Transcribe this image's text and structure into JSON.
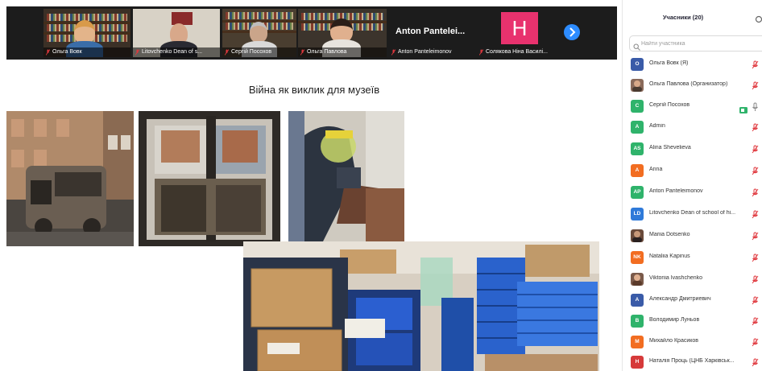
{
  "video_strip": {
    "tiles": [
      {
        "caption": "Ольга Вовк"
      },
      {
        "caption": "Litovchenko Dean of s..."
      },
      {
        "caption": "Сергій Посохов"
      },
      {
        "caption": "Ольга Павлова"
      },
      {
        "name": "Anton Pantelei...",
        "caption": "Anton Panteleimonov"
      },
      {
        "avatar_letter": "Н",
        "caption": "Солякова Ніна Василі..."
      }
    ],
    "next_icon": "chevron-right-icon"
  },
  "slide": {
    "title": "Війна як виклик для музеїв"
  },
  "participants": {
    "title": "Учасники (20)",
    "search_placeholder": "Найти участника",
    "items": [
      {
        "initials": "О",
        "name": "Ольга Вовк (Я)",
        "color": "#3a5ba8",
        "mic": "muted"
      },
      {
        "initials": "",
        "name": "Ольга Павлова (Организатор)",
        "color": "#8a6a5a",
        "mic": "muted",
        "photo": true
      },
      {
        "initials": "С",
        "name": "Сергій Посохов",
        "color": "#2fb36b",
        "mic": "on",
        "video": true
      },
      {
        "initials": "A",
        "name": "Admin",
        "color": "#2fb36b",
        "mic": "muted"
      },
      {
        "initials": "AS",
        "name": "Alina Shevelieva",
        "color": "#2fb36b",
        "mic": "muted"
      },
      {
        "initials": "A",
        "name": "Anna",
        "color": "#f26d21",
        "mic": "muted"
      },
      {
        "initials": "AP",
        "name": "Anton Panteleimonov",
        "color": "#2fb36b",
        "mic": "muted"
      },
      {
        "initials": "LD",
        "name": "Litovchenko Dean of school of hi...",
        "color": "#2f7ad9",
        "mic": "muted"
      },
      {
        "initials": "",
        "name": "Mariia Dotsenko",
        "color": "#6a4a3a",
        "mic": "muted",
        "photo": true
      },
      {
        "initials": "NK",
        "name": "Nataliia Kapinus",
        "color": "#f26d21",
        "mic": "muted"
      },
      {
        "initials": "",
        "name": "Viktoriia Ivashchenko",
        "color": "#7a5a4a",
        "mic": "muted",
        "photo": true
      },
      {
        "initials": "А",
        "name": "Александр Дмитриевич",
        "color": "#3a5ba8",
        "mic": "muted"
      },
      {
        "initials": "В",
        "name": "Володимир Луньов",
        "color": "#2fb36b",
        "mic": "muted"
      },
      {
        "initials": "М",
        "name": "Михайло Красиков",
        "color": "#f26d21",
        "mic": "muted"
      },
      {
        "initials": "Н",
        "name": "Наталія Проць (ЦНБ Харківськ...",
        "color": "#d63a3a",
        "mic": "muted"
      }
    ]
  },
  "colors": {
    "accent": "#2d8cff",
    "muted_mic": "#e0383e",
    "video_green": "#2fb36b"
  }
}
